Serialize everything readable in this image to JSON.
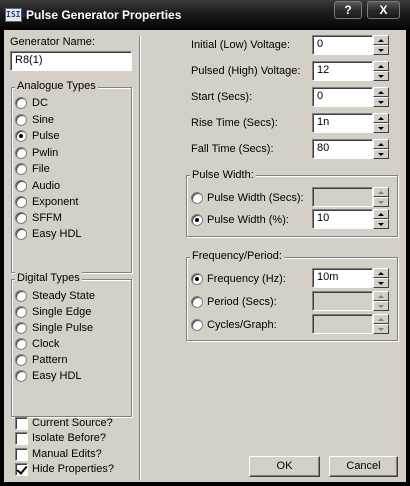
{
  "window": {
    "title": "Pulse Generator Properties",
    "app_icon_text": "ISIS",
    "help_label": "?",
    "close_label": "X"
  },
  "generator_name": {
    "label": "Generator Name:",
    "value": "R8(1)"
  },
  "analogue_types": {
    "title": "Analogue Types",
    "selected": "Pulse",
    "options": [
      "DC",
      "Sine",
      "Pulse",
      "Pwlin",
      "File",
      "Audio",
      "Exponent",
      "SFFM",
      "Easy HDL"
    ]
  },
  "digital_types": {
    "title": "Digital Types",
    "selected": "",
    "options": [
      "Steady State",
      "Single Edge",
      "Single Pulse",
      "Clock",
      "Pattern",
      "Easy HDL"
    ]
  },
  "options": [
    {
      "label": "Current Source?",
      "checked": false
    },
    {
      "label": "Isolate Before?",
      "checked": false
    },
    {
      "label": "Manual Edits?",
      "checked": false
    },
    {
      "label": "Hide Properties?",
      "checked": true
    }
  ],
  "params": {
    "initial_voltage": {
      "label": "Initial (Low) Voltage:",
      "value": "0"
    },
    "pulsed_voltage": {
      "label": "Pulsed (High) Voltage:",
      "value": "12"
    },
    "start": {
      "label": "Start (Secs):",
      "value": "0"
    },
    "rise_time": {
      "label": "Rise Time (Secs):",
      "value": "1n"
    },
    "fall_time": {
      "label": "Fall Time (Secs):",
      "value": "80"
    }
  },
  "pulse_width": {
    "title": "Pulse Width:",
    "secs": {
      "label": "Pulse Width (Secs):",
      "value": "",
      "checked": false
    },
    "percent": {
      "label": "Pulse Width (%):",
      "value": "10",
      "checked": true
    }
  },
  "frequency_period": {
    "title": "Frequency/Period:",
    "frequency": {
      "label": "Frequency (Hz):",
      "value": "10m",
      "checked": true
    },
    "period": {
      "label": "Period (Secs):",
      "value": "",
      "checked": false
    },
    "cycles": {
      "label": "Cycles/Graph:",
      "value": "",
      "checked": false
    }
  },
  "buttons": {
    "ok": "OK",
    "cancel": "Cancel"
  },
  "icons": {
    "app": "isis-app-icon",
    "spinner_up": "spin-up-icon",
    "spinner_down": "spin-down-icon"
  }
}
